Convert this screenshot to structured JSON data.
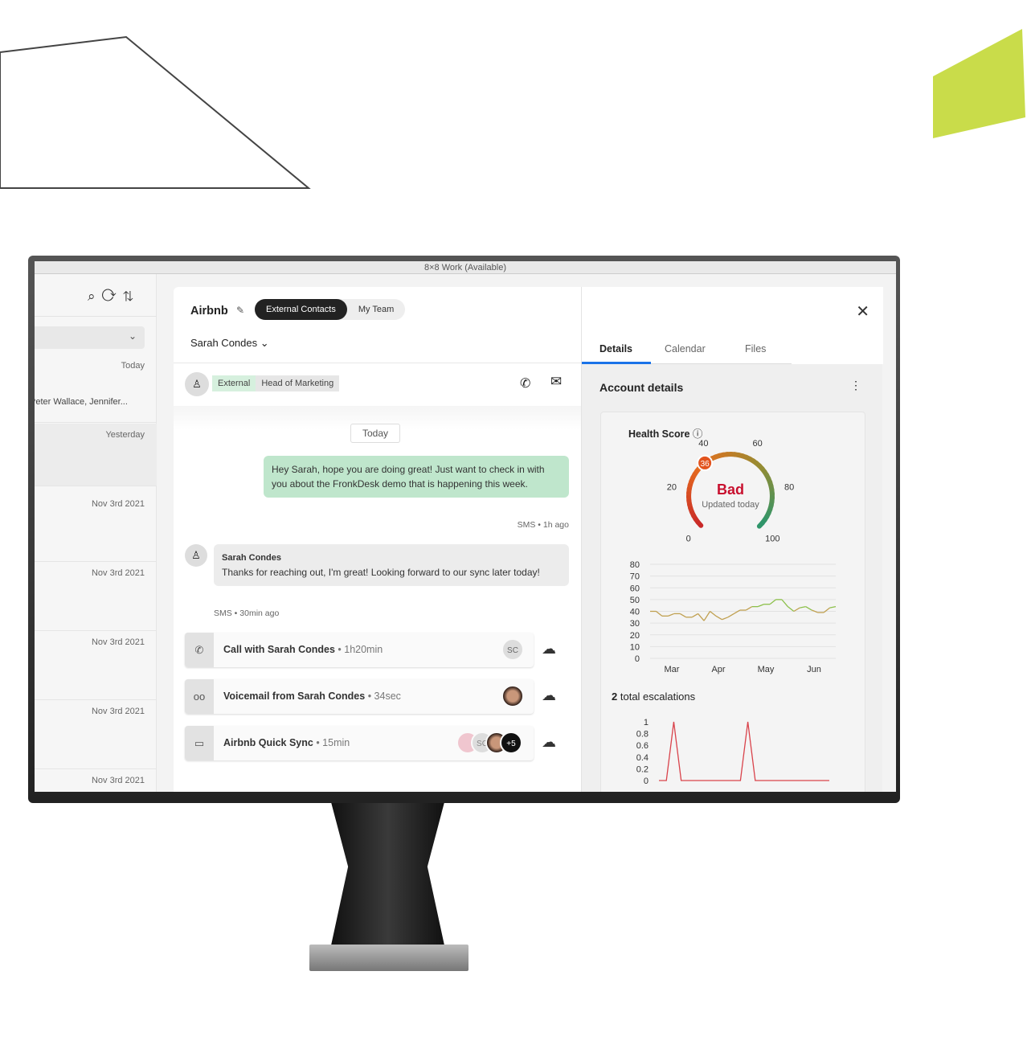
{
  "window": {
    "title": "8×8 Work (Available)"
  },
  "sidebar": {
    "icons": [
      "search-icon",
      "refresh-icon",
      "sort-icon"
    ],
    "rows": [
      {
        "preview": "",
        "date": "Today"
      },
      {
        "preview": "Peter Wallace, Jennifer...",
        "date": ""
      },
      {
        "preview": "",
        "date": "Yesterday"
      },
      {
        "preview": "",
        "date": "Nov 3rd 2021"
      },
      {
        "preview": "",
        "date": "Nov 3rd 2021"
      },
      {
        "preview": "",
        "date": "Nov 3rd 2021"
      },
      {
        "preview": "",
        "date": "Nov 3rd 2021"
      },
      {
        "preview": "",
        "date": "Nov 3rd 2021"
      }
    ]
  },
  "header": {
    "account": "Airbnb",
    "tabs": [
      "External Contacts",
      "My Team"
    ],
    "active_tab": "External Contacts",
    "contact": "Sarah Condes"
  },
  "contact_bar": {
    "tags": [
      "External",
      "Head of Marketing"
    ]
  },
  "chat": {
    "day_divider": "Today",
    "messages": [
      {
        "from": "me",
        "text": "Hey Sarah, hope you are doing great! Just want to check in with you about the FronkDesk demo that is happening this week.",
        "meta": "SMS • 1h ago"
      },
      {
        "from": "Sarah Condes",
        "text": "Thanks for reaching out, I'm great! Looking forward to our sync later today!",
        "meta": "SMS • 30min ago"
      }
    ],
    "activities": [
      {
        "icon": "phone-icon",
        "title": "Call with Sarah Condes",
        "detail": " • 1h20min",
        "avatar": "SC",
        "status_icon": "cloud-upload-icon"
      },
      {
        "icon": "voicemail-icon",
        "title": "Voicemail from Sarah Condes",
        "detail": " • 34sec",
        "status_icon": "cloud-error-icon"
      },
      {
        "icon": "video-icon",
        "title": "Airbnb Quick Sync ",
        "detail": " • 15min",
        "avatar": "SC",
        "extra": "+5",
        "status_icon": "cloud-check-icon"
      }
    ]
  },
  "details": {
    "tabs": [
      "Details",
      "Calendar",
      "Files"
    ],
    "active_tab": "Details",
    "section": "Account details",
    "health": {
      "title": "Health Score",
      "score": 36,
      "label": "Bad",
      "updated": "Updated today",
      "ticks": [
        "0",
        "20",
        "40",
        "60",
        "80",
        "100"
      ],
      "label_color": "#c8102e"
    },
    "escalations": {
      "count": "2",
      "label": "total escalations"
    }
  },
  "chart_data": [
    {
      "type": "line",
      "ylim": [
        0,
        80
      ],
      "yticks": [
        "80",
        "70",
        "60",
        "50",
        "40",
        "30",
        "20",
        "10",
        "0"
      ],
      "xticks": [
        "Mar",
        "Apr",
        "May",
        "Jun"
      ],
      "values": [
        40,
        40,
        36,
        36,
        38,
        38,
        35,
        35,
        38,
        32,
        40,
        36,
        33,
        35,
        38,
        41,
        41,
        44,
        44,
        46,
        46,
        50,
        50,
        44,
        40,
        43,
        44,
        41,
        39,
        39,
        43,
        44
      ],
      "grid": true
    },
    {
      "type": "line",
      "ylim": [
        0,
        1
      ],
      "yticks": [
        "1",
        "0.8",
        "0.6",
        "0.4",
        "0.2",
        "0"
      ],
      "values": [
        0,
        0,
        1,
        0,
        0,
        0,
        0,
        0,
        0,
        0,
        0,
        0,
        1,
        0,
        0,
        0,
        0,
        0,
        0,
        0,
        0,
        0,
        0,
        0
      ],
      "color": "#d9434b"
    }
  ]
}
